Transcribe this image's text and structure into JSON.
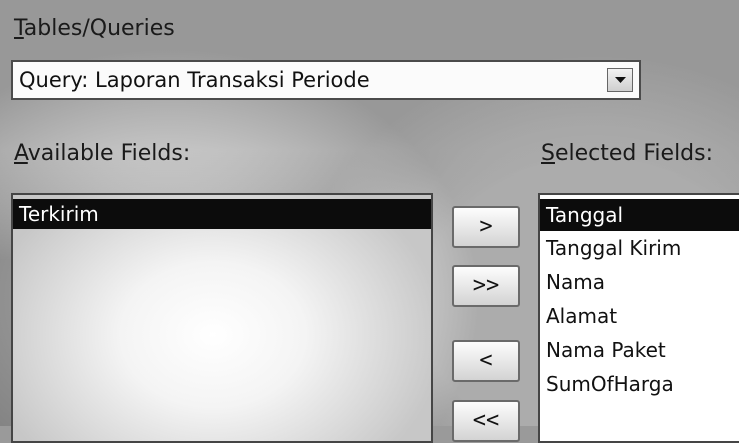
{
  "labels": {
    "tables_queries": {
      "accel": "T",
      "rest": "ables/Queries"
    },
    "available_fields": {
      "accel": "A",
      "rest": "vailable Fields:"
    },
    "selected_fields": {
      "accel": "S",
      "rest": "elected Fields:"
    }
  },
  "combo": {
    "value": "Query: Laporan Transaksi Periode",
    "button_icon": "chevron-down-icon"
  },
  "available_fields": {
    "items": [
      "Terkirim"
    ],
    "selected_index": 0
  },
  "selected_fields": {
    "items": [
      "Tanggal",
      "Tanggal Kirim",
      "Nama",
      "Alamat",
      "Nama Paket",
      "SumOfHarga"
    ],
    "selected_index": 0
  },
  "buttons": {
    "add": ">",
    "add_all": ">>",
    "remove": "<",
    "remove_all": "<<"
  },
  "colors": {
    "selection_bg": "#0c0c0c",
    "selection_text": "#ffffff",
    "border": "#454545"
  }
}
